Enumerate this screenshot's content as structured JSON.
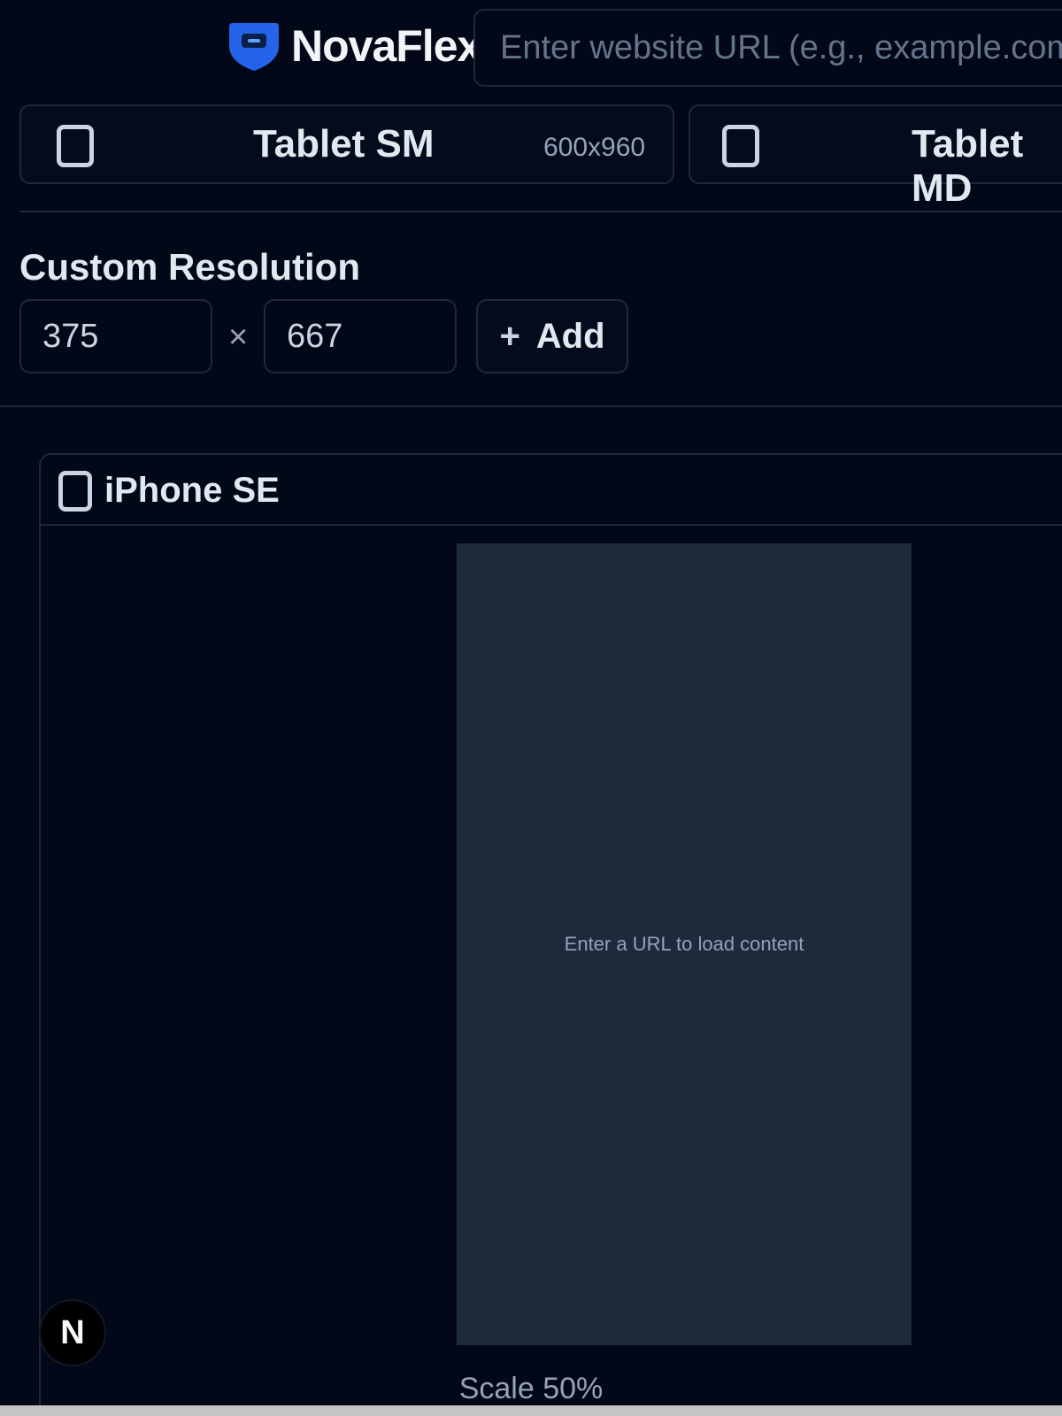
{
  "brand": {
    "name": "NovaFlex"
  },
  "url_bar": {
    "placeholder": "Enter website URL (e.g., example.com)",
    "value": ""
  },
  "presets": [
    {
      "name": "Tablet SM",
      "resolution": "600x960"
    },
    {
      "name": "Tablet MD",
      "resolution": ""
    }
  ],
  "custom_resolution": {
    "title": "Custom Resolution",
    "width": "375",
    "height": "667",
    "separator": "×",
    "add_label": "Add"
  },
  "preview": {
    "device_name": "iPhone SE",
    "hint": "Enter a URL to load content",
    "scale_label": "Scale 50%"
  },
  "fab": {
    "label": "N"
  },
  "colors": {
    "background": "#020817",
    "border": "#1e293b",
    "viewport": "#1e293b",
    "brand_accent": "#2563eb"
  }
}
